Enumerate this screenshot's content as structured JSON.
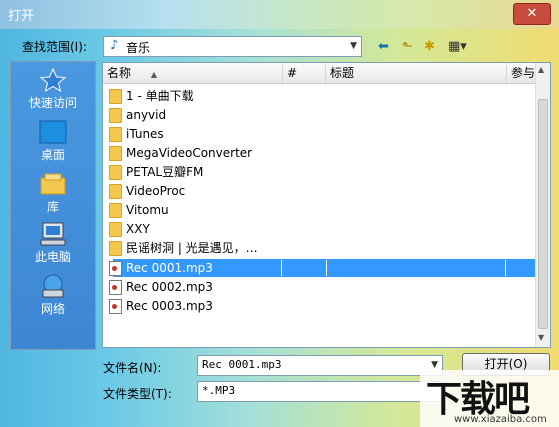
{
  "window": {
    "title": "打开",
    "close_glyph": "✕"
  },
  "look_in": {
    "label": "查找范围(I):",
    "value": "音乐",
    "music_glyph": "♪"
  },
  "toolbar": {
    "back_glyph": "⬅",
    "up_glyph": "⬑",
    "new_folder_glyph": "✱",
    "view_glyph": "▦▾"
  },
  "places": [
    {
      "label": "快速访问",
      "icon": "star-icon"
    },
    {
      "label": "桌面",
      "icon": "desktop-icon"
    },
    {
      "label": "库",
      "icon": "library-icon"
    },
    {
      "label": "此电脑",
      "icon": "computer-icon"
    },
    {
      "label": "网络",
      "icon": "network-icon"
    }
  ],
  "columns": {
    "name": "名称",
    "sort_glyph": "▲",
    "number": "#",
    "title": "标题",
    "artist": "参与"
  },
  "files": [
    {
      "name": "1 - 单曲下载",
      "type": "folder"
    },
    {
      "name": "anyvid",
      "type": "folder"
    },
    {
      "name": "iTunes",
      "type": "folder"
    },
    {
      "name": "MegaVideoConverter",
      "type": "folder"
    },
    {
      "name": "PETAL豆瓣FM",
      "type": "folder"
    },
    {
      "name": "VideoProc",
      "type": "folder"
    },
    {
      "name": "Vitomu",
      "type": "folder"
    },
    {
      "name": "XXY",
      "type": "folder"
    },
    {
      "name": "民谣树洞 | 光是遇见，…",
      "type": "folder"
    },
    {
      "name": "Rec 0001.mp3",
      "type": "mp3",
      "selected": true
    },
    {
      "name": "Rec 0002.mp3",
      "type": "mp3"
    },
    {
      "name": "Rec 0003.mp3",
      "type": "mp3"
    }
  ],
  "filename": {
    "label": "文件名(N):",
    "value": "Rec 0001.mp3"
  },
  "filetype": {
    "label": "文件类型(T):",
    "value": "*.MP3"
  },
  "buttons": {
    "open": "打开(O)"
  },
  "watermark": {
    "big": "下载吧",
    "small": "www.xiazaiba.com"
  },
  "colors": {
    "selection": "#3399ff",
    "close": "#c94b3b"
  }
}
